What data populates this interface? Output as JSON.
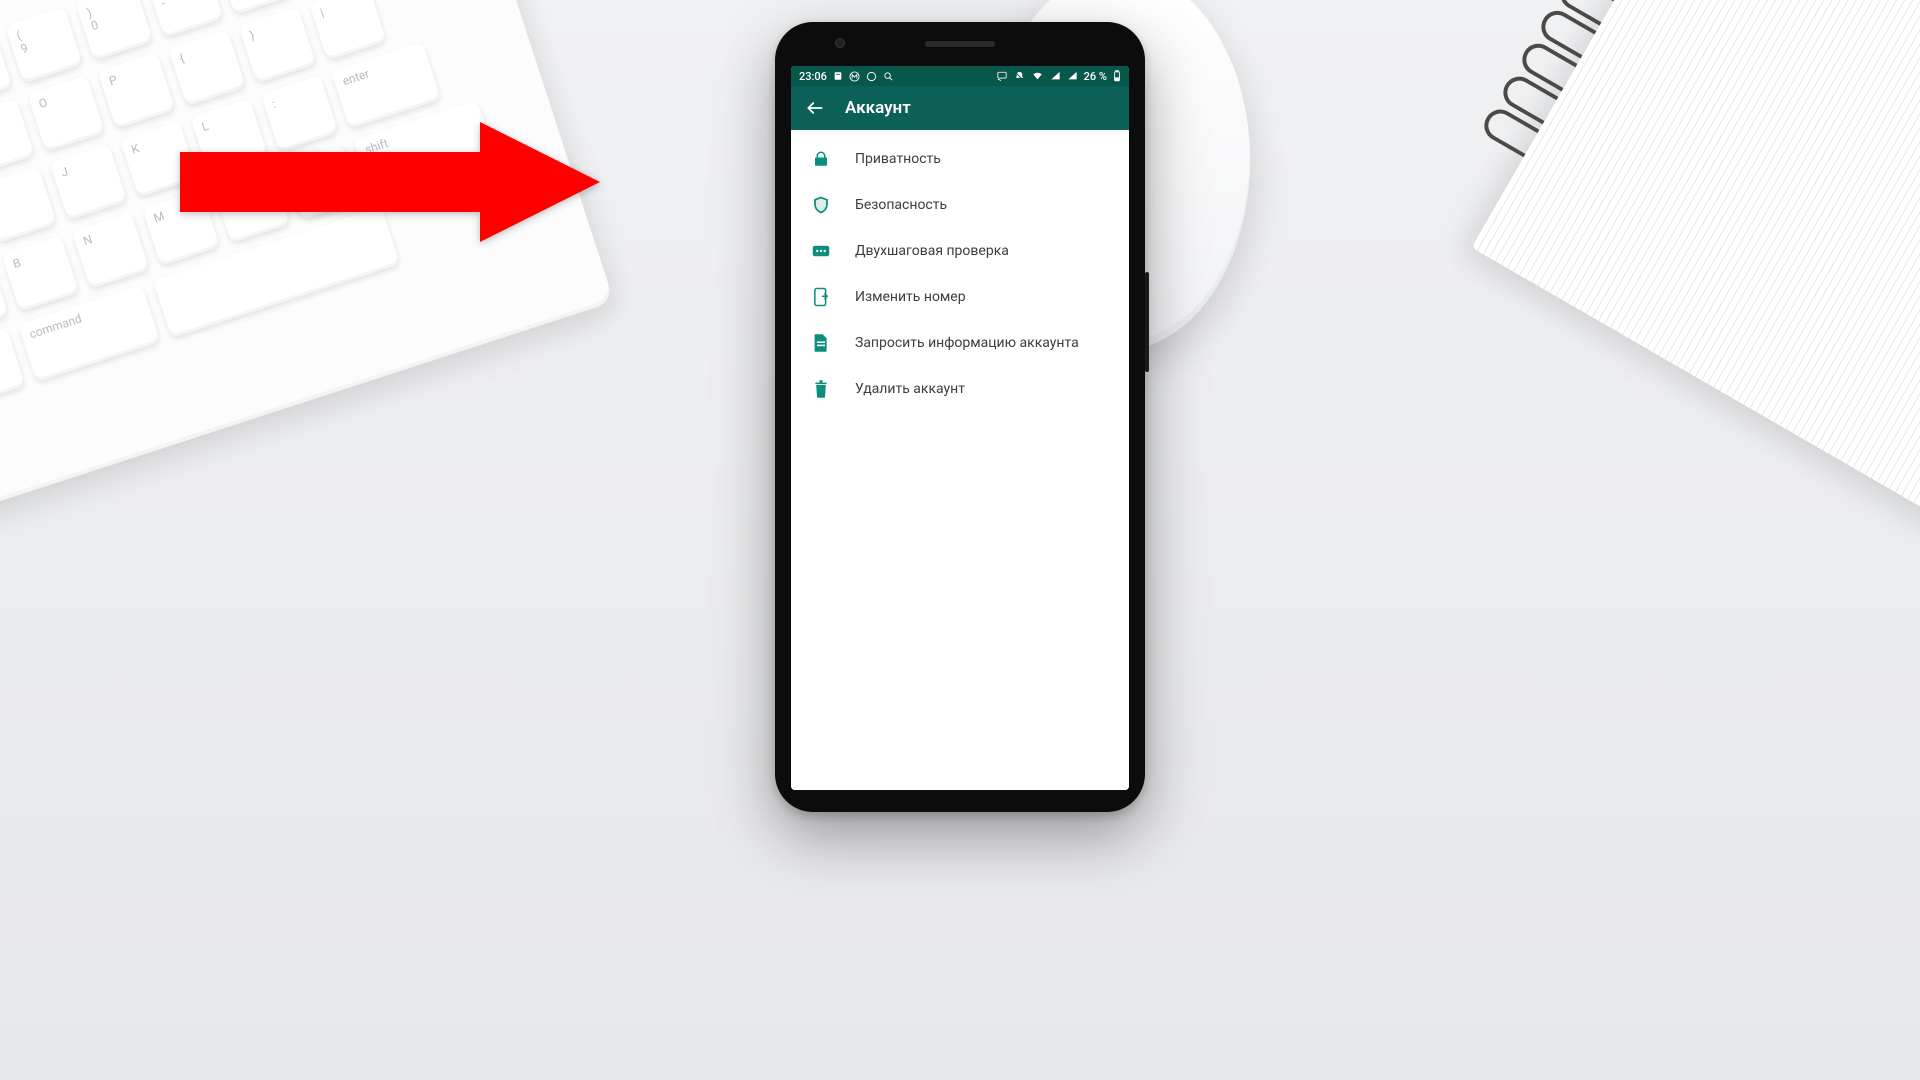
{
  "statusbar": {
    "time": "23:06",
    "battery_text": "26 %"
  },
  "appbar": {
    "title": "Аккаунт"
  },
  "menu": {
    "items": [
      {
        "icon": "lock-icon",
        "label": "Приватность"
      },
      {
        "icon": "shield-icon",
        "label": "Безопасность"
      },
      {
        "icon": "password-icon",
        "label": "Двухшаговая проверка"
      },
      {
        "icon": "sim-icon",
        "label": "Изменить номер"
      },
      {
        "icon": "document-icon",
        "label": "Запросить информацию аккаунта"
      },
      {
        "icon": "trash-icon",
        "label": "Удалить аккаунт"
      }
    ]
  },
  "colors": {
    "accent": "#0b6157",
    "accent_light": "#0b8f7d",
    "arrow": "#fe0000"
  }
}
